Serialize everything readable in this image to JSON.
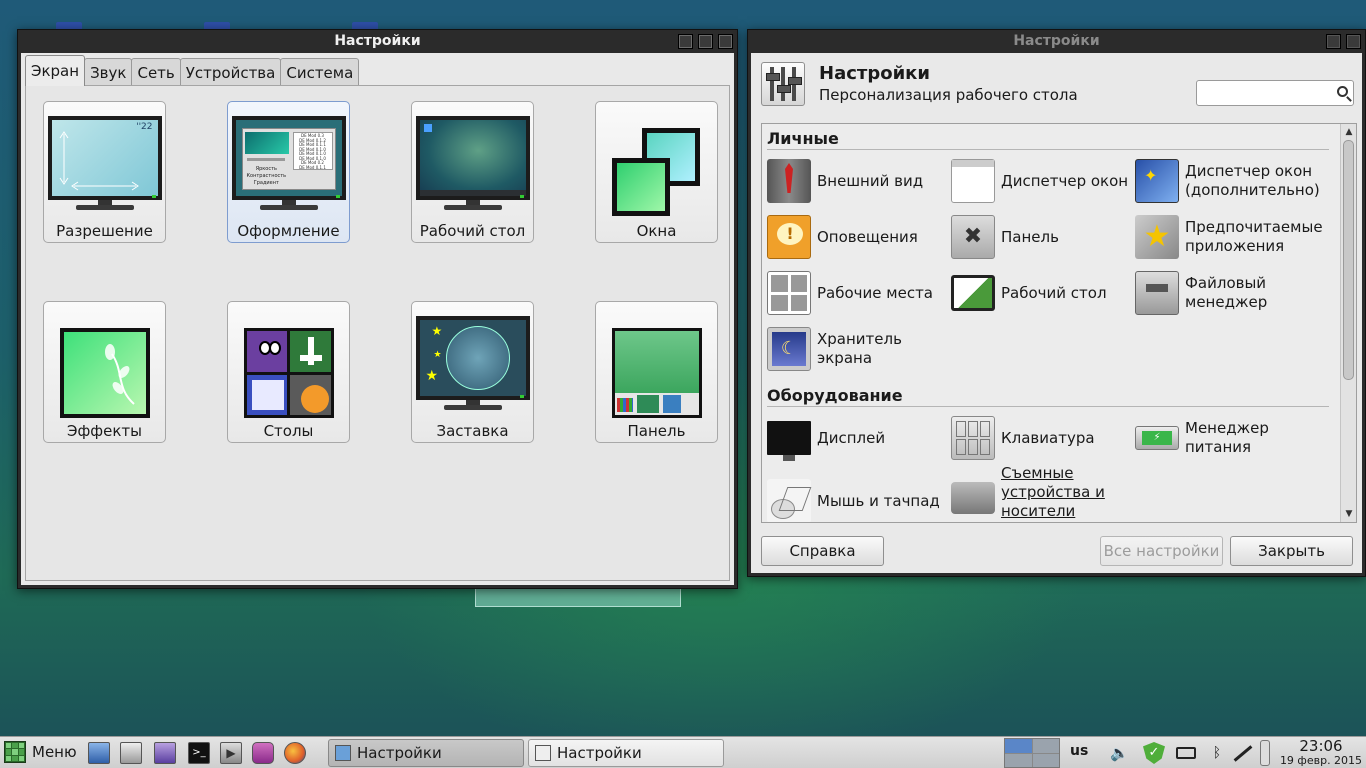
{
  "left_window": {
    "title": "Настройки",
    "tabs": [
      "Экран",
      "Звук",
      "Сеть",
      "Устройства",
      "Система"
    ],
    "tiles": [
      {
        "label": "Разрешение",
        "clock": "''22"
      },
      {
        "label": "Оформление"
      },
      {
        "label": "Рабочий стол"
      },
      {
        "label": "Окна"
      },
      {
        "label": "Эффекты"
      },
      {
        "label": "Столы"
      },
      {
        "label": "Заставка"
      },
      {
        "label": "Панель"
      }
    ],
    "theme_preview": {
      "options": [
        "Яркость",
        "Контрастность",
        "Градиент"
      ],
      "list_rows": [
        "DE Mod 0.3",
        "DE Mod 0.1.2",
        "DE Mod 0.1.1",
        "DE Mod 0.1.0",
        "DE Mod 0.1.0",
        "DE Mod 0.1.0",
        "DE Mod 0.2",
        "DE Mod 0.1.1"
      ]
    }
  },
  "right_window": {
    "title": "Настройки",
    "header": {
      "title": "Настройки",
      "subtitle": "Персонализация рабочего стола",
      "search_placeholder": ""
    },
    "sections": [
      {
        "title": "Личные",
        "items": [
          {
            "label": "Внешний вид",
            "icon": "suit-tie-icon"
          },
          {
            "label": "Диспетчер окон",
            "icon": "window-manager-icon"
          },
          {
            "label": "Диспетчер окон (дополнительно)",
            "icon": "window-manager-tweaks-icon"
          },
          {
            "label": "Оповещения",
            "icon": "notification-bubble-icon"
          },
          {
            "label": "Панель",
            "icon": "panel-icon"
          },
          {
            "label": "Предпочитаемые приложения",
            "icon": "preferred-apps-star-icon"
          },
          {
            "label": "Рабочие места",
            "icon": "workspaces-grid-icon"
          },
          {
            "label": "Рабочий стол",
            "icon": "desktop-monitor-icon"
          },
          {
            "label": "Файловый менеджер",
            "icon": "file-manager-drawer-icon"
          },
          {
            "label": "Хранитель экрана",
            "icon": "screensaver-moon-icon"
          }
        ]
      },
      {
        "title": "Оборудование",
        "items": [
          {
            "label": "Дисплей",
            "icon": "display-monitor-icon"
          },
          {
            "label": "Клавиатура",
            "icon": "keyboard-icon"
          },
          {
            "label": "Менеджер питания",
            "icon": "battery-icon"
          },
          {
            "label": "Мышь и тачпад",
            "icon": "mouse-touchpad-icon"
          },
          {
            "label": "Съемные устройства и носители данных",
            "icon": "removable-drive-icon"
          }
        ]
      }
    ],
    "buttons": {
      "help": "Справка",
      "all_settings": "Все настройки",
      "close": "Закрыть"
    }
  },
  "taskbar": {
    "menu_label": "Меню",
    "tasks": [
      {
        "label": "Настройки",
        "active": true
      },
      {
        "label": "Настройки",
        "active": false
      }
    ],
    "keyboard_layout": "us",
    "clock_time": "23:06",
    "clock_date": "19 февр. 2015"
  },
  "colors": {
    "accent_green": "#2e9a3e",
    "selection_blue": "#7e9ccf",
    "titlebar": "#2b2b2b"
  }
}
